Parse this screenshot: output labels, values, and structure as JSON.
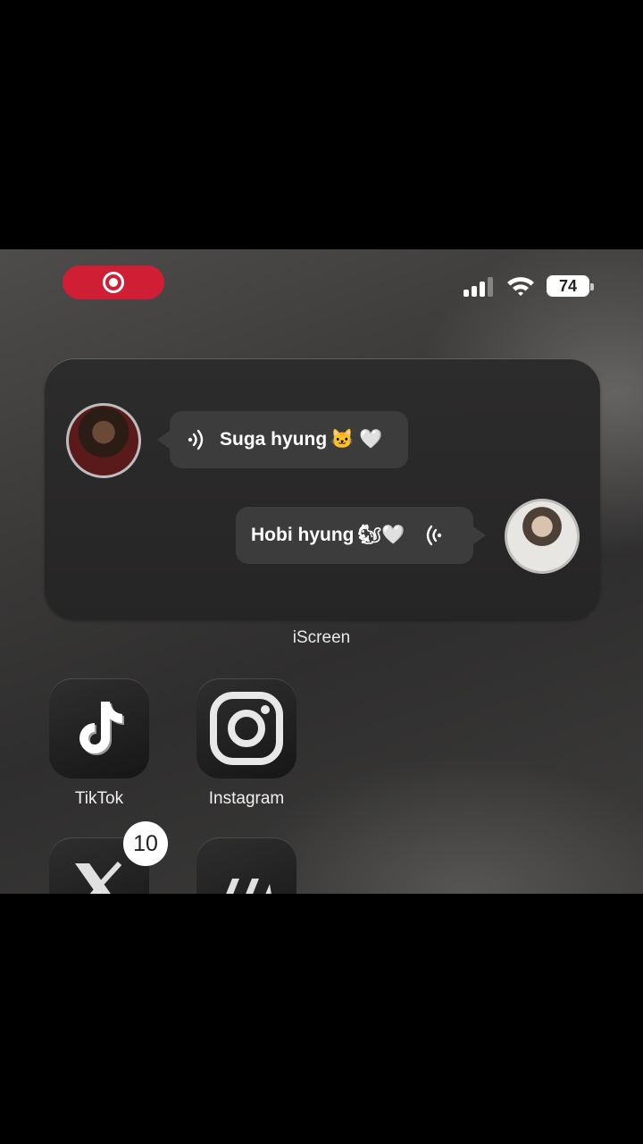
{
  "status_bar": {
    "battery_level": "74",
    "recording_icon": "screen-record-icon",
    "signal_icon": "cellular-signal-icon",
    "wifi_icon": "wifi-icon"
  },
  "widget": {
    "name": "iScreen",
    "messages": [
      {
        "text": "Suga hyung",
        "emoji": "🐱 🤍",
        "side": "left",
        "icon": "voice-message-icon"
      },
      {
        "text": "Hobi hyung",
        "emoji": "🐿🤍",
        "side": "right",
        "icon": "voice-message-icon"
      }
    ]
  },
  "apps": [
    {
      "label": "TikTok",
      "icon": "tiktok-icon"
    },
    {
      "label": "Instagram",
      "icon": "instagram-icon"
    },
    {
      "label": "",
      "icon": "x-twitter-icon",
      "badge": "10"
    },
    {
      "label": "",
      "icon": "app-logo-icon"
    }
  ],
  "colors": {
    "record_pill": "#d01f34",
    "widget_bg": "#2a2929",
    "bubble_bg": "#3d3c3c"
  }
}
